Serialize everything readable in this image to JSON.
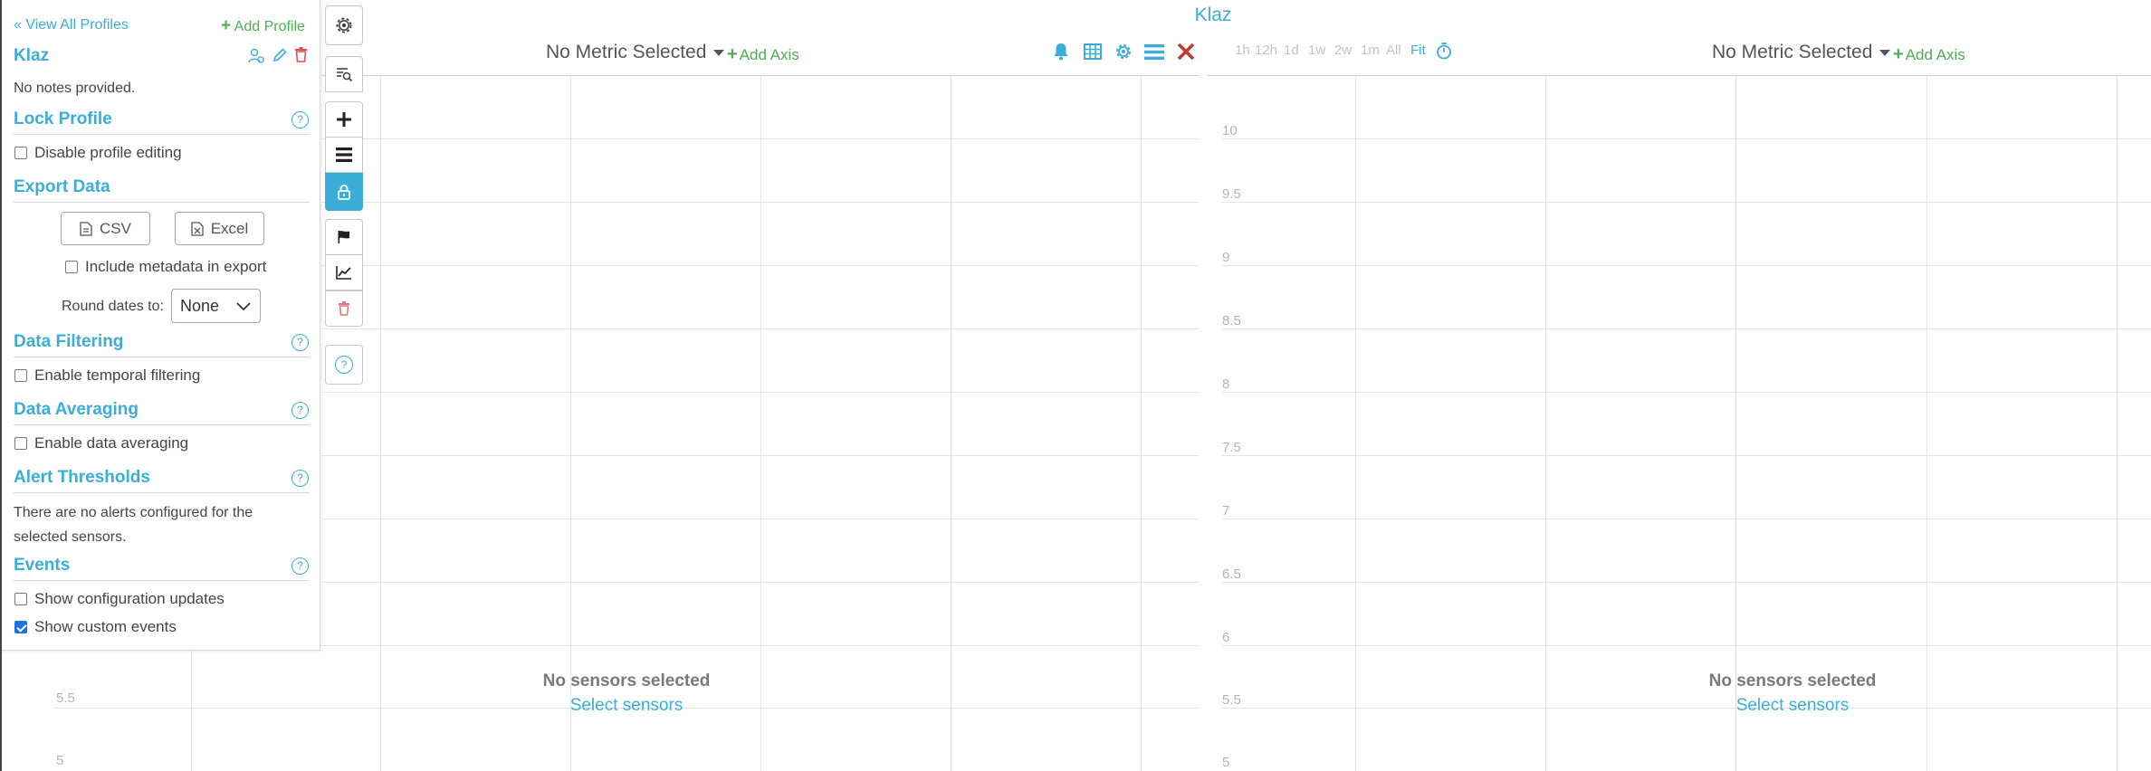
{
  "profile": {
    "view_all_label": "« View All Profiles",
    "add_profile_label": "Add Profile",
    "name": "Klaz",
    "notes": "No notes provided."
  },
  "sections": {
    "lock": {
      "title": "Lock Profile",
      "checkbox": "Disable profile editing",
      "checked": false
    },
    "export": {
      "title": "Export Data",
      "csv_label": "CSV",
      "excel_label": "Excel",
      "metadata_label": "Include metadata in export",
      "round_label": "Round dates to:",
      "round_value": "None"
    },
    "filtering": {
      "title": "Data Filtering",
      "checkbox": "Enable temporal filtering"
    },
    "averaging": {
      "title": "Data Averaging",
      "checkbox": "Enable data averaging"
    },
    "alerts": {
      "title": "Alert Thresholds",
      "text": "There are no alerts configured for the selected sensors."
    },
    "events": {
      "title": "Events",
      "config_label": "Show configuration updates",
      "custom_label": "Show custom events",
      "custom_checked": true
    }
  },
  "page_title": "Klaz",
  "left_chart": {
    "metric_label": "No Metric Selected",
    "add_axis_label": "Add Axis",
    "empty_title": "No sensors selected",
    "empty_link": "Select sensors",
    "ticks": [
      "5.5",
      "5"
    ]
  },
  "right_chart": {
    "metric_label": "No Metric Selected",
    "add_axis_label": "Add Axis",
    "empty_title": "No sensors selected",
    "empty_link": "Select sensors",
    "time_ranges": [
      "1h",
      "12h",
      "1d",
      "1w",
      "2w",
      "1m",
      "All",
      "Fit"
    ],
    "ticks": [
      "10",
      "9.5",
      "9",
      "8.5",
      "8",
      "7.5",
      "7",
      "6.5",
      "6",
      "5.5",
      "5"
    ]
  },
  "colors": {
    "accent": "#3aaed8",
    "add": "#4caf50",
    "close": "#c0392b",
    "delete": "#e07a7a"
  }
}
